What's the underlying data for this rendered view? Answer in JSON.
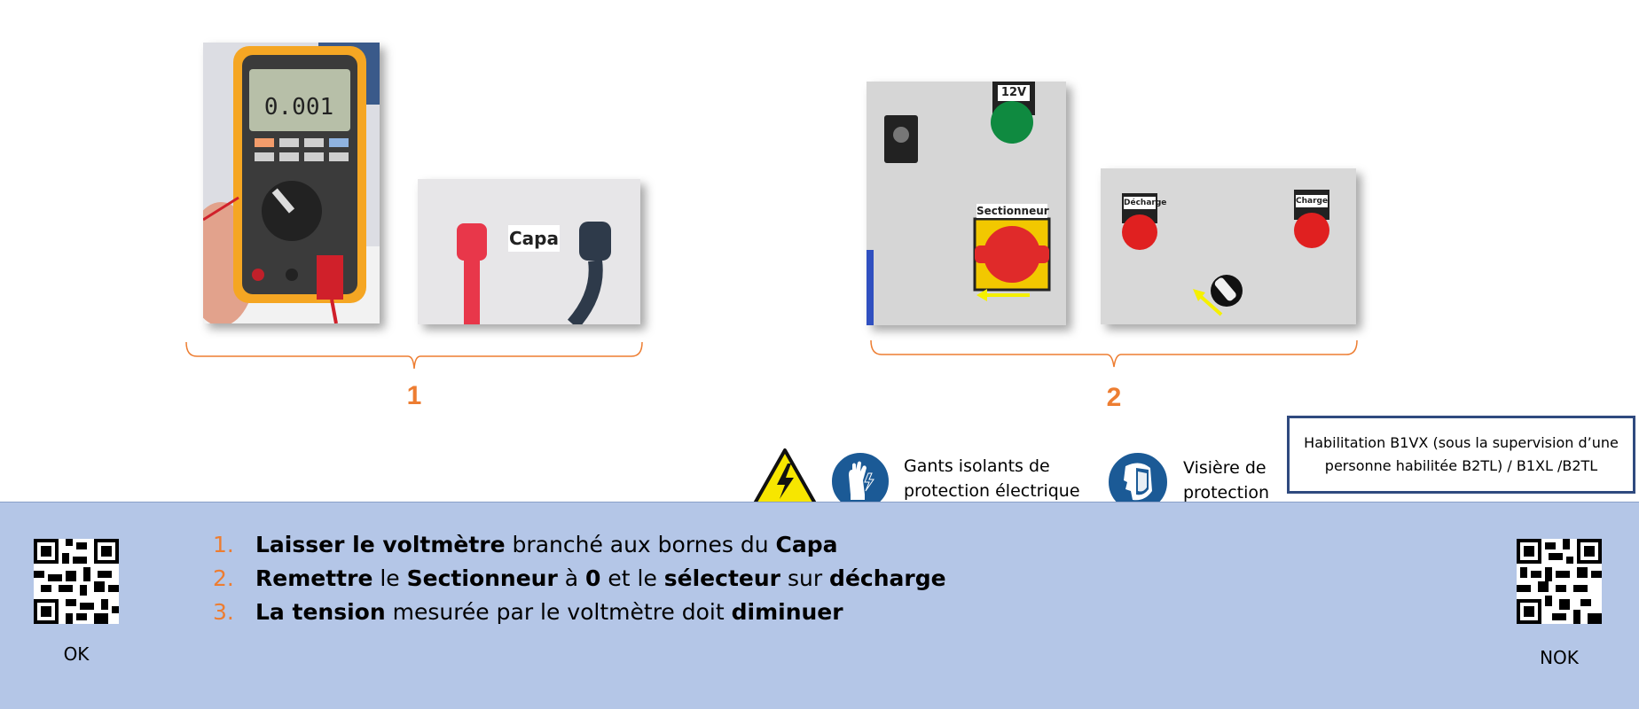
{
  "steps_group": [
    {
      "number": "1"
    },
    {
      "number": "2"
    }
  ],
  "photos": {
    "multimeter_display": "0.001",
    "capa_label": "Capa",
    "panel_voltage_label": "12V",
    "sectionneur_label": "Sectionneur",
    "decharge_label": "Décharge",
    "charge_label": "Charge"
  },
  "ppe": {
    "gloves": {
      "line1": "Gants isolants de",
      "line2": "protection électrique"
    },
    "visor": {
      "line1": "Visière de",
      "line2": "protection"
    }
  },
  "habilitation": "Habilitation B1VX (sous la supervision d’une personne habilitée B2TL) / B1XL /B2TL",
  "instructions": [
    {
      "number": "1.",
      "parts": [
        {
          "text": "Laisser le voltmètre",
          "bold": true
        },
        {
          "text": " branché aux bornes du ",
          "bold": false
        },
        {
          "text": "Capa",
          "bold": true
        }
      ]
    },
    {
      "number": "2.",
      "parts": [
        {
          "text": "Remettre",
          "bold": true
        },
        {
          "text": " le ",
          "bold": false
        },
        {
          "text": "Sectionneur",
          "bold": true
        },
        {
          "text": " à ",
          "bold": false
        },
        {
          "text": "0",
          "bold": true
        },
        {
          "text": " et le ",
          "bold": false
        },
        {
          "text": "sélecteur",
          "bold": true
        },
        {
          "text": " sur ",
          "bold": false
        },
        {
          "text": "décharge",
          "bold": true
        }
      ]
    },
    {
      "number": "3.",
      "parts": [
        {
          "text": "La tension",
          "bold": true
        },
        {
          "text": " mesurée par le voltmètre doit ",
          "bold": false
        },
        {
          "text": "diminuer",
          "bold": true
        }
      ]
    }
  ],
  "qr": {
    "ok_label": "OK",
    "nok_label": "NOK"
  },
  "colors": {
    "accent": "#ed7d31",
    "band": "#b4c6e7",
    "frame": "#2f4a7f",
    "ppe_blue": "#1b5a96"
  }
}
